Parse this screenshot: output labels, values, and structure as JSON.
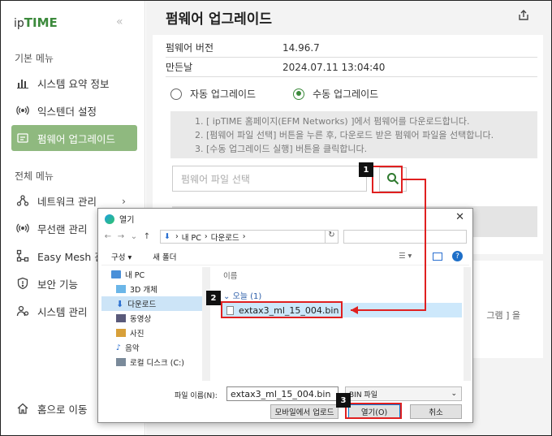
{
  "sidebar": {
    "logo_prefix": "ip",
    "logo_main": "TIME",
    "section_basic": "기본 메뉴",
    "basic_items": [
      {
        "label": "시스템 요약 정보",
        "icon": "bar-chart-icon"
      },
      {
        "label": "익스텐더 설정",
        "icon": "wireless-icon"
      },
      {
        "label": "펌웨어 업그레이드",
        "icon": "firmware-icon",
        "active": true
      }
    ],
    "section_all": "전체 메뉴",
    "all_items": [
      {
        "label": "네트워크 관리",
        "icon": "network-icon"
      },
      {
        "label": "무선랜 관리",
        "icon": "wireless-icon"
      },
      {
        "label": "Easy Mesh 관",
        "icon": "mesh-icon"
      },
      {
        "label": "보안 기능",
        "icon": "shield-icon"
      },
      {
        "label": "시스템 관리",
        "icon": "system-icon"
      }
    ],
    "home": "홈으로 이동"
  },
  "main": {
    "title": "펌웨어 업그레이드",
    "info": [
      {
        "key": "펌웨어 버전",
        "value": "14.96.7"
      },
      {
        "key": "만든날",
        "value": "2024.07.11 13:04:40"
      }
    ],
    "radio_auto": "자동 업그레이드",
    "radio_manual": "수동 업그레이드",
    "notes": [
      "1. [ ipTIME 홈페이지(EFM Networks) ]에서 펌웨어를 다운로드합니다.",
      "2. [펌웨어 파일 선택] 버튼을 누른 후, 다운로드 받은 펌웨어 파일을 선택합니다.",
      "3. [수동 업그레이드 실행] 버튼을 클릭합니다."
    ],
    "file_placeholder": "펌웨어 파일 선택",
    "card2_tail": "그램 ] 을"
  },
  "dialog": {
    "title": "열기",
    "path": [
      "내 PC",
      "다운로드"
    ],
    "toolbar_organize": "구성 ▾",
    "toolbar_newfolder": "새 폴더",
    "tree": [
      {
        "label": "내 PC",
        "icon": "pc-icon"
      },
      {
        "label": "3D 개체",
        "icon": "cube-icon"
      },
      {
        "label": "다운로드",
        "icon": "download-icon",
        "selected": true
      },
      {
        "label": "동영상",
        "icon": "video-icon"
      },
      {
        "label": "사진",
        "icon": "picture-icon"
      },
      {
        "label": "음악",
        "icon": "music-icon"
      },
      {
        "label": "로컬 디스크 (C:)",
        "icon": "disk-icon"
      }
    ],
    "column_name": "이름",
    "group_today": "오늘 (1)",
    "file_name": "extax3_ml_15_004.bin",
    "filename_label": "파일 이름(N):",
    "filename_value": "extax3_ml_15_004.bin",
    "filetype": "BIN 파일",
    "btn_mobile": "모바일에서 업로드",
    "btn_open": "열기(O)",
    "btn_cancel": "취소"
  },
  "badges": [
    "1",
    "2",
    "3"
  ],
  "colors": {
    "accent_green": "#8fb97f",
    "annotation_red": "#e02020"
  }
}
